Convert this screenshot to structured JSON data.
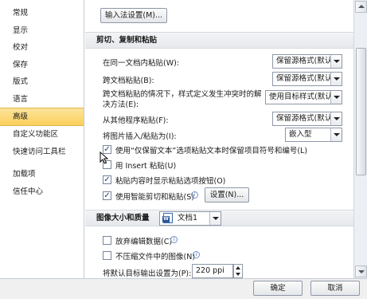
{
  "sidebar": {
    "items": [
      {
        "label": "常规"
      },
      {
        "label": "显示"
      },
      {
        "label": "校对"
      },
      {
        "label": "保存"
      },
      {
        "label": "版式"
      },
      {
        "label": "语言"
      },
      {
        "label": "高级",
        "selected": true
      },
      {
        "label": "自定义功能区"
      },
      {
        "label": "快速访问工具栏"
      },
      {
        "label": "加载项"
      },
      {
        "label": "信任中心"
      }
    ]
  },
  "content": {
    "ime_button": "输入法设置(M)...",
    "cut_copy_paste": {
      "heading": "剪切、复制和粘贴",
      "within_doc": {
        "label": "在同一文档内粘贴(W):",
        "value": "保留源格式(默认)"
      },
      "across_docs": {
        "label": "跨文档粘贴(B):",
        "value": "保留源格式(默认)"
      },
      "across_docs_conflict": {
        "label_line1": "跨文档粘贴的情况下，样式定义发生冲突时的解",
        "label_line2": "决方法(E):",
        "value": "使用目标样式(默认)"
      },
      "other_programs": {
        "label": "从其他程序粘贴(F):",
        "value": "保留源格式(默认)"
      },
      "insert_picture": {
        "label": "将图片插入/粘贴为(I):",
        "value": "嵌入型"
      },
      "keep_bullets": {
        "label": "使用“仅保留文本”选项粘贴文本时保留项目符号和编号(L)",
        "checked": true
      },
      "use_insert_key": {
        "label": "用 Insert 粘贴(U)",
        "checked": false
      },
      "show_paste_options": {
        "label": "粘贴内容时显示粘贴选项按钮(O)",
        "checked": true
      },
      "smart_cut": {
        "label": "使用智能剪切和粘贴(S)",
        "checked": true
      },
      "settings_button": "设置(N)..."
    },
    "image_size_quality": {
      "heading": "图像大小和质量",
      "document": "文档1",
      "discard_editing_data": {
        "label": "放弃编辑数据(C)",
        "checked": false
      },
      "no_compress": {
        "label": "不压缩文件中的图像(N)",
        "checked": false
      },
      "default_target_output": {
        "label": "将默认目标输出设置为(P):",
        "value": "220 ppi"
      }
    }
  },
  "footer": {
    "ok": "确定",
    "cancel": "取消"
  },
  "colors": {
    "selected_item": "#fbcf5c",
    "check_color": "#1c3f7a",
    "info_icon": "#3e68b3"
  },
  "icons": [
    "info-icon",
    "document-icon",
    "dropdown-arrow-icon",
    "mouse-cursor-icon"
  ]
}
